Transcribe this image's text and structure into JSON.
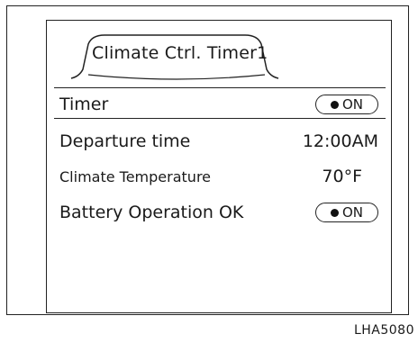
{
  "screen": {
    "title": "Climate Ctrl. Timer1",
    "rows": [
      {
        "label": "Timer",
        "value": "ON",
        "value_type": "toggle",
        "toggle_state": "on"
      },
      {
        "label": "Departure time",
        "value": "12:00AM",
        "value_type": "text"
      },
      {
        "label": "Climate Temperature",
        "value": "70°F",
        "value_type": "text"
      },
      {
        "label": "Battery Operation OK",
        "value": "ON",
        "value_type": "toggle",
        "toggle_state": "on"
      }
    ]
  },
  "figure_code": "LHA5080"
}
